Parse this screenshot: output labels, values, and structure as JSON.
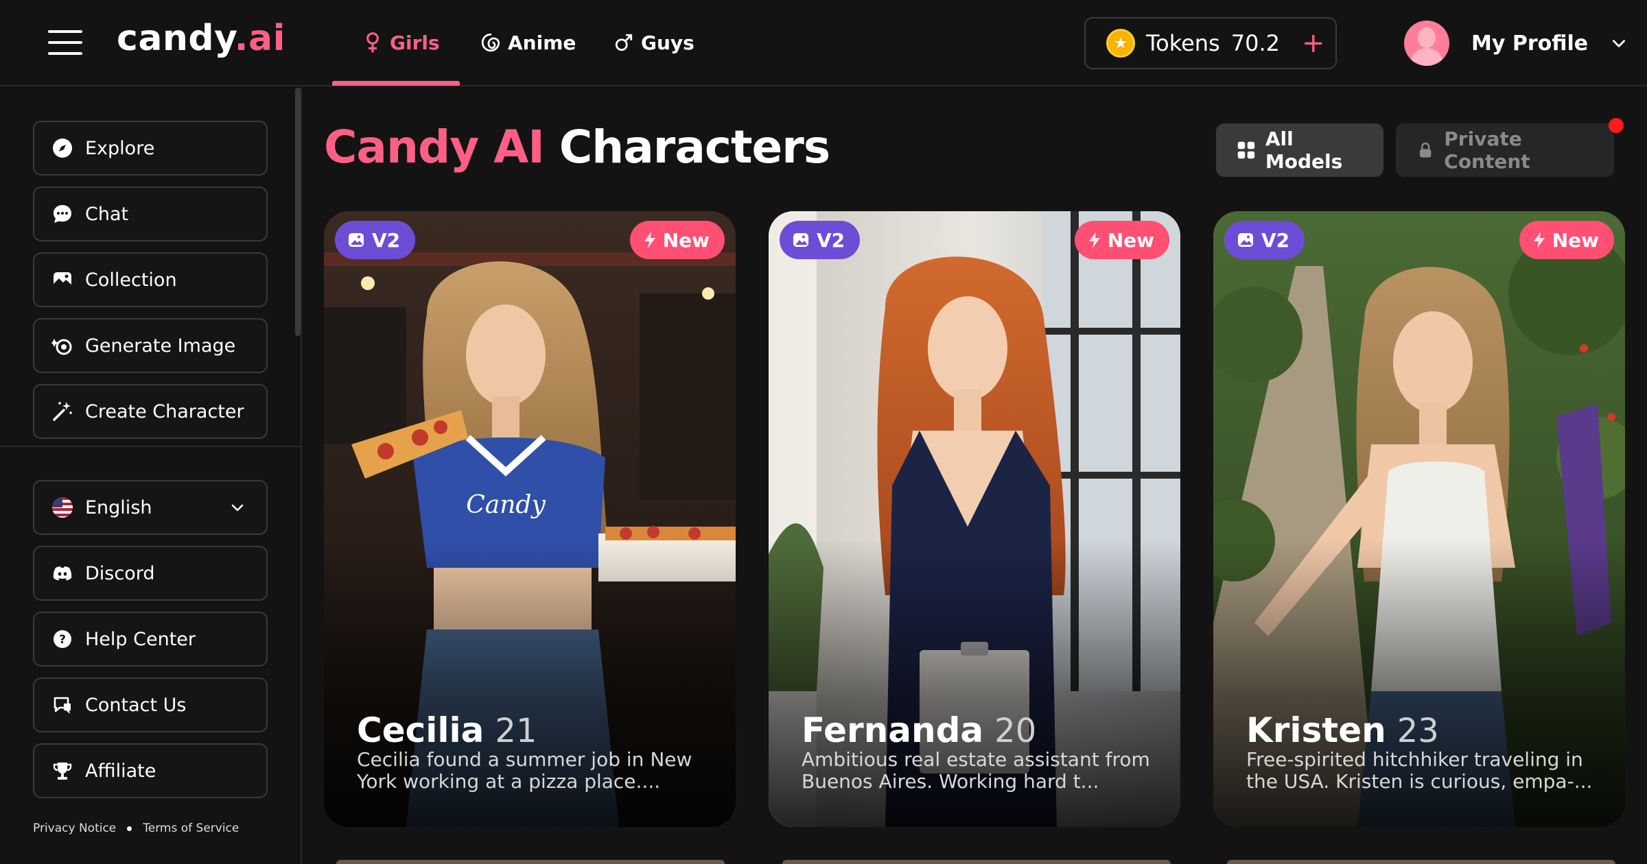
{
  "header": {
    "logo_main": "candy",
    "logo_accent": ".ai",
    "tabs": [
      {
        "label": "Girls",
        "active": true
      },
      {
        "label": "Anime",
        "active": false
      },
      {
        "label": "Guys",
        "active": false
      }
    ],
    "tokens": {
      "label": "Tokens",
      "value": "70.2",
      "add": "+"
    },
    "profile": {
      "label": "My Profile"
    }
  },
  "sidebar": {
    "items": [
      {
        "label": "Explore",
        "icon": "compass-icon"
      },
      {
        "label": "Chat",
        "icon": "chat-bubble-icon"
      },
      {
        "label": "Collection",
        "icon": "image-gallery-icon"
      },
      {
        "label": "Generate Image",
        "icon": "generate-image-icon"
      },
      {
        "label": "Create Character",
        "icon": "magic-wand-icon"
      }
    ],
    "secondary": [
      {
        "label": "English",
        "icon": "us-flag-icon"
      },
      {
        "label": "Discord",
        "icon": "discord-icon"
      },
      {
        "label": "Help Center",
        "icon": "help-circle-icon"
      },
      {
        "label": "Contact Us",
        "icon": "contact-icon"
      },
      {
        "label": "Affiliate",
        "icon": "trophy-icon"
      }
    ],
    "legal": {
      "privacy": "Privacy Notice",
      "terms": "Terms of Service"
    }
  },
  "main": {
    "title_accent": "Candy AI",
    "title_rest": "Characters",
    "filters": {
      "all": "All Models",
      "private": "Private Content"
    },
    "cards": [
      {
        "badge_v2": "V2",
        "badge_new": "New",
        "name": "Cecilia",
        "age": "21",
        "description": "Cecilia found a summer job in New York working at a pizza place...."
      },
      {
        "badge_v2": "V2",
        "badge_new": "New",
        "name": "Fernanda",
        "age": "20",
        "description": "Ambitious real estate assistant from Buenos Aires. Working hard t..."
      },
      {
        "badge_v2": "V2",
        "badge_new": "New",
        "name": "Kristen",
        "age": "23",
        "description": "Free-spirited hitchhiker traveling in the USA. Kristen is curious, empa-..."
      }
    ]
  },
  "colors": {
    "accent": "#ff5f85",
    "background": "#131313",
    "v2_badge": "#6d4dd6",
    "new_badge": "#ff4f73"
  }
}
